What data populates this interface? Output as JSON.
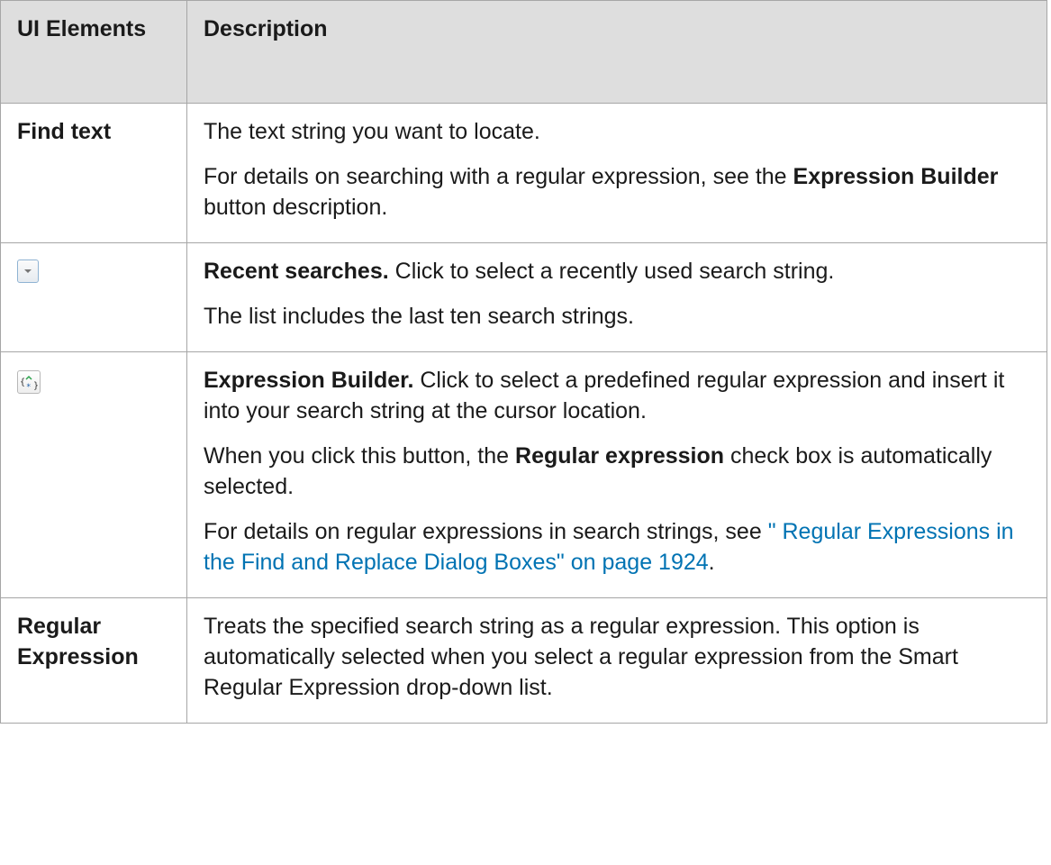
{
  "header": {
    "col1": "UI Elements",
    "col2": "Description"
  },
  "rows": {
    "find_text": {
      "label": "Find text",
      "p1": "The text string you want to locate.",
      "p2_pre": "For details on searching with a regular expression, see the ",
      "p2_bold": "Expression Builder",
      "p2_post": " button description."
    },
    "recent": {
      "icon": "dropdown-arrow-icon",
      "bold": "Recent searches.",
      "text": " Click to select a recently used search string.",
      "p2": "The list includes the last ten search strings."
    },
    "expression_builder": {
      "icon": "expression-builder-icon",
      "bold": "Expression Builder.",
      "text": " Click to select a predefined regular expression and insert it into your search string at the cursor location.",
      "p2_pre": "When you click this button, the ",
      "p2_bold": "Regular expression",
      "p2_post": " check box is automatically selected.",
      "p3_pre": "For details on regular expressions in search strings, see ",
      "p3_link": "\" Regular Expressions in the Find and Replace Dialog Boxes\" on page 1924",
      "p3_post": "."
    },
    "regex": {
      "label": "Regular Expression",
      "text": "Treats the specified search string as a regular expression. This option is automatically selected when you select a regular expression from the Smart Regular Expression drop-down list."
    }
  }
}
